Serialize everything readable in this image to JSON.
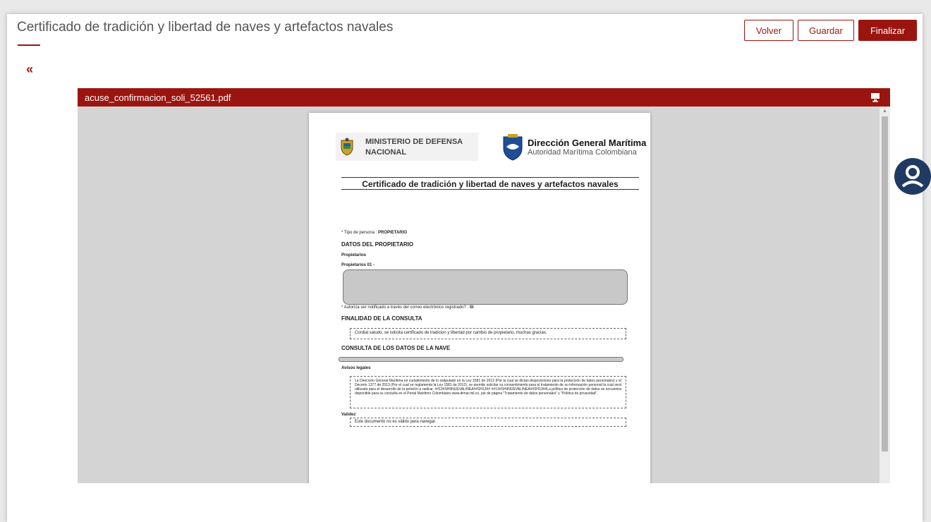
{
  "header": {
    "title": "Certificado de tradición y libertad de naves y artefactos navales",
    "buttons": {
      "back": "Volver",
      "save": "Guardar",
      "finish": "Finalizar"
    },
    "collapse_glyph": "«"
  },
  "viewer": {
    "filename": "acuse_confirmacion_soli_52561.pdf",
    "icons": [
      "monitor-icon"
    ]
  },
  "document": {
    "ministry_line1": "MINISTERIO DE DEFENSA",
    "ministry_line2": "NACIONAL",
    "agency_title": "Dirección General Marítima",
    "agency_subtitle": "Autoridad Marítima Colombiana",
    "title": "Certificado de tradición y libertad de naves y artefactos navales",
    "person_type_label": "* Tipo de persona  :",
    "person_type_value": "PROPIETARIO",
    "owner_section": "DATOS DEL PROPIETARIO",
    "owners_label": "Propietarios",
    "owners_item": "Propietarios 01 -",
    "notify_label": "* Autoriza ser notificado a través del correo electrónico registrado?  :",
    "notify_value": "SI",
    "purpose_section": "FINALIDAD DE LA CONSULTA",
    "purpose_text": "Cordial saludo, se solicita certificado de tradicion y libertad por cambio de propietario, muchas gracias.",
    "vessel_section": "CONSULTA DE LOS DATOS DE LA NAVE",
    "legal_label": "Avisos legales",
    "legal_text": "La Dirección General Marítima  en cumplimiento de lo estipulado en la Ley 1581 de 2012 (Por la cual se dictan disposiciones para la protección de datos personales) y el Decreto 1377 de 2013 (Por el cual se reglamenta la Ley 1581 de 2012), se permite solicitar su consentimiento para el tratamiento de su información personal la cual será utilizada para el desarrollo de la petición a radicar. ##13#SHIINUEVALINEA##SH13## ##13#SHIINUEVALINEA##SH13##La política de protección de datos se encuentra disponible para su consulta en el Portal Marítimo Colombiano www.dimar.mil.co, pie de página \"Tratamiento de datos personales\" y \"Política de privacidad\".",
    "validity_label": "Validez",
    "validity_text": "Este documento no es válido para navegar."
  },
  "colors": {
    "accent": "#9b1510",
    "viewer_bg": "#d4d4d4",
    "page_bg": "#ffffff"
  }
}
